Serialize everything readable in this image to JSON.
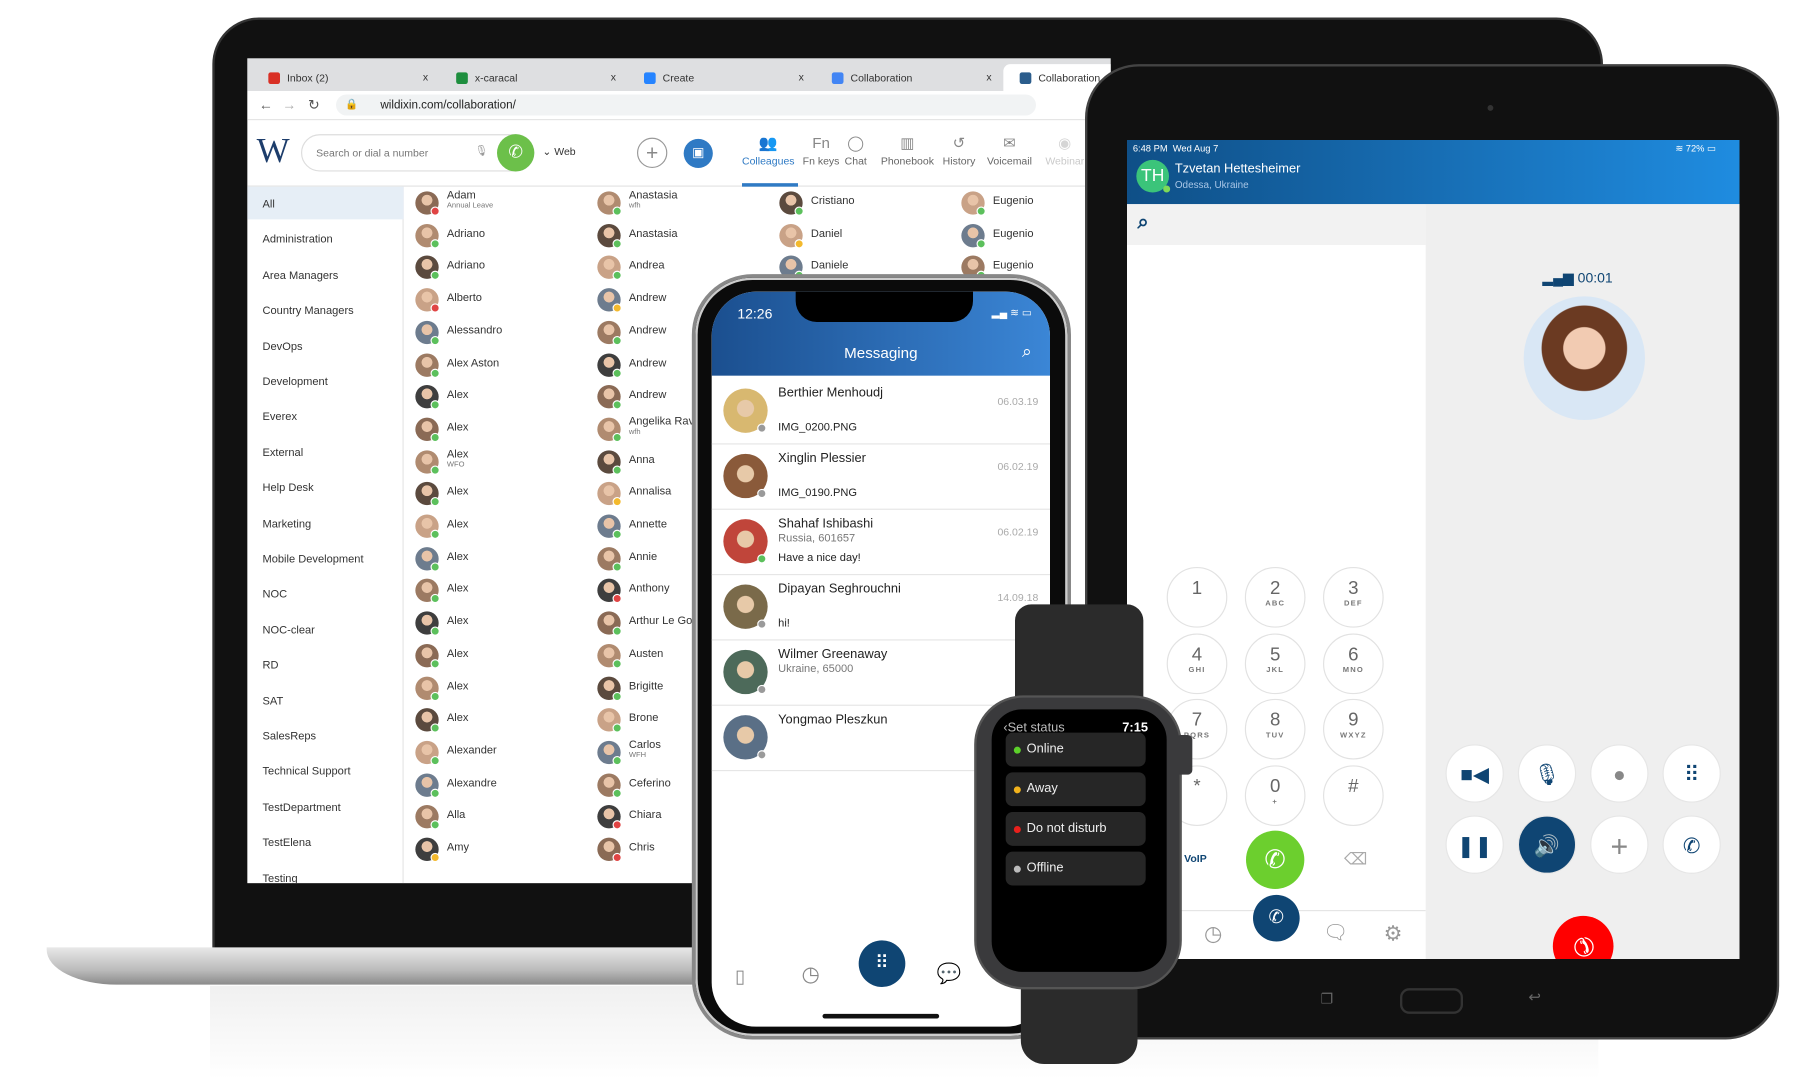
{
  "browser": {
    "tabs": [
      {
        "label": "Inbox (2)",
        "icon_color": "#d93025"
      },
      {
        "label": "x-caracal",
        "icon_color": "#1e8e3e"
      },
      {
        "label": "Create",
        "icon_color": "#2684ff"
      },
      {
        "label": "Collaboration",
        "icon_color": "#4285f4"
      },
      {
        "label": "Collaboration",
        "icon_color": "#2b5d8c"
      }
    ],
    "close": "x",
    "url": "wildixin.com/collaboration/"
  },
  "app": {
    "logo": "W",
    "search_placeholder": "Search or dial a number",
    "mode": "Web",
    "nav": [
      {
        "label": "Colleagues",
        "icon": "people-icon"
      },
      {
        "label": "Fn keys",
        "icon": "fn-icon"
      },
      {
        "label": "Chat",
        "icon": "chat-icon"
      },
      {
        "label": "Phonebook",
        "icon": "book-icon"
      },
      {
        "label": "History",
        "icon": "history-icon"
      },
      {
        "label": "Voicemail",
        "icon": "voicemail-icon"
      },
      {
        "label": "Webinar",
        "icon": "webinar-icon"
      }
    ],
    "active_nav": "Colleagues",
    "groups": [
      "All",
      "Administration",
      "Area Managers",
      "Country Managers",
      "DevOps",
      "Development",
      "Everex",
      "External",
      "Help Desk",
      "Marketing",
      "Mobile Development",
      "NOC",
      "NOC-clear",
      "RD",
      "SAT",
      "SalesReps",
      "Technical Support",
      "TestDepartment",
      "TestElena",
      "Testing"
    ],
    "status_colors": {
      "online": "#5cc05c",
      "away": "#f3b92d",
      "busy": "#e04444",
      "offline": "#9a9a9a"
    },
    "contact_columns": [
      [
        {
          "name": "Adam",
          "sub": "Annual Leave",
          "status": "busy"
        },
        {
          "name": "Adriano",
          "status": "online"
        },
        {
          "name": "Adriano",
          "status": "online"
        },
        {
          "name": "Alberto",
          "status": "busy"
        },
        {
          "name": "Alessandro",
          "status": "online"
        },
        {
          "name": "Alex Aston",
          "status": "online"
        },
        {
          "name": "Alex",
          "status": "online"
        },
        {
          "name": "Alex",
          "status": "online"
        },
        {
          "name": "Alex",
          "sub": "WFO",
          "status": "online"
        },
        {
          "name": "Alex",
          "status": "online"
        },
        {
          "name": "Alex",
          "status": "online"
        },
        {
          "name": "Alex",
          "status": "online"
        },
        {
          "name": "Alex",
          "status": "online"
        },
        {
          "name": "Alex",
          "status": "online"
        },
        {
          "name": "Alex",
          "status": "online"
        },
        {
          "name": "Alex",
          "status": "online"
        },
        {
          "name": "Alex",
          "status": "online"
        },
        {
          "name": "Alexander",
          "status": "online"
        },
        {
          "name": "Alexandre",
          "status": "online"
        },
        {
          "name": "Alla",
          "status": "online"
        },
        {
          "name": "Amy",
          "status": "away"
        }
      ],
      [
        {
          "name": "Anastasia",
          "sub": "wfh",
          "status": "online"
        },
        {
          "name": "Anastasia",
          "status": "online"
        },
        {
          "name": "Andrea",
          "status": "online"
        },
        {
          "name": "Andrew",
          "status": "away"
        },
        {
          "name": "Andrew",
          "status": "online"
        },
        {
          "name": "Andrew",
          "status": "online"
        },
        {
          "name": "Andrew",
          "status": "online"
        },
        {
          "name": "Angelika Rave",
          "sub": "wfh",
          "status": "online"
        },
        {
          "name": "Anna",
          "status": "online"
        },
        {
          "name": "Annalisa",
          "status": "away"
        },
        {
          "name": "Annette",
          "status": "online"
        },
        {
          "name": "Annie",
          "status": "online"
        },
        {
          "name": "Anthony",
          "status": "busy"
        },
        {
          "name": "Arthur Le Goff",
          "status": "online"
        },
        {
          "name": "Austen",
          "status": "online"
        },
        {
          "name": "Brigitte",
          "status": "online"
        },
        {
          "name": "Brone",
          "status": "online"
        },
        {
          "name": "Carlos",
          "sub": "WFH",
          "status": "online"
        },
        {
          "name": "Ceferino",
          "status": "online"
        },
        {
          "name": "Chiara",
          "status": "busy"
        },
        {
          "name": "Chris",
          "status": "busy"
        }
      ],
      [
        {
          "name": "Cristiano",
          "status": "online"
        },
        {
          "name": "Daniel",
          "status": "away"
        },
        {
          "name": "Daniele",
          "status": "online"
        }
      ],
      [
        {
          "name": "Eugenio",
          "status": "online"
        },
        {
          "name": "Eugenio",
          "status": "online"
        },
        {
          "name": "Eugenio",
          "status": "online"
        }
      ]
    ]
  },
  "phone": {
    "time": "12:26",
    "title": "Messaging",
    "messages": [
      {
        "name": "Berthier Menhoudj",
        "text": "IMG_0200.PNG",
        "date": "06.03.19",
        "status": "offline"
      },
      {
        "name": "Xinglin Plessier",
        "text": "IMG_0190.PNG",
        "date": "06.02.19",
        "status": "offline"
      },
      {
        "name": "Shahaf Ishibashi",
        "sub": "Russia, 601657",
        "text": "Have a nice day!",
        "date": "06.02.19",
        "status": "online"
      },
      {
        "name": "Dipayan Seghrouchni",
        "text": "hi!",
        "date": "14.09.18",
        "status": "offline"
      },
      {
        "name": "Wilmer Greenaway",
        "sub": "Ukraine, 65000",
        "status": "offline"
      },
      {
        "name": "Yongmao Pleszkun",
        "status": "offline"
      }
    ]
  },
  "watch": {
    "back": "‹",
    "title": "Set status",
    "time": "7:15",
    "options": [
      {
        "label": "Online",
        "color": "#5cd02a"
      },
      {
        "label": "Away",
        "color": "#f1b21c"
      },
      {
        "label": "Do not disturb",
        "color": "#e8201c"
      },
      {
        "label": "Offline",
        "color": "#bbbbbb"
      }
    ]
  },
  "tablet": {
    "time": "6:48 PM",
    "date": "Wed Aug 7",
    "battery": "72%",
    "caller_initials": "TH",
    "caller_name": "Tzvetan Hettesheimer",
    "caller_location": "Odessa, Ukraine",
    "call_timer": "00:01",
    "keypad": [
      {
        "d": "1",
        "l": ""
      },
      {
        "d": "2",
        "l": "ABC"
      },
      {
        "d": "3",
        "l": "DEF"
      },
      {
        "d": "4",
        "l": "GHI"
      },
      {
        "d": "5",
        "l": "JKL"
      },
      {
        "d": "6",
        "l": "MNO"
      },
      {
        "d": "7",
        "l": "PQRS"
      },
      {
        "d": "8",
        "l": "TUV"
      },
      {
        "d": "9",
        "l": "WXYZ"
      },
      {
        "d": "*",
        "l": ""
      },
      {
        "d": "0",
        "l": "+"
      },
      {
        "d": "#",
        "l": ""
      }
    ],
    "voip_label": "VoIP",
    "accent": "#0f4573",
    "call_green": "#6ccf2e",
    "hangup_red": "#ff0000"
  }
}
